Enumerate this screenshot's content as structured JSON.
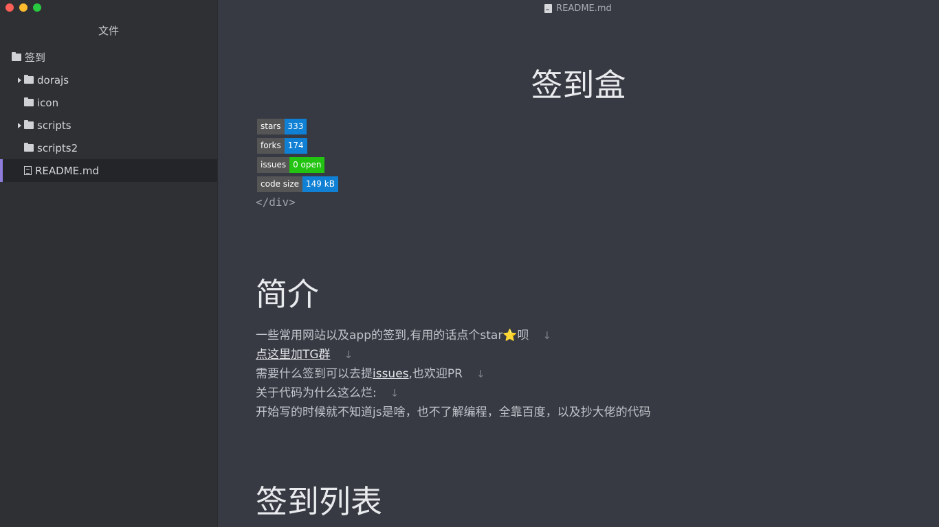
{
  "window": {
    "title": "README.md"
  },
  "sidebar": {
    "header": "文件",
    "items": [
      {
        "label": "签到",
        "type": "folder",
        "level": 0,
        "expandable": false
      },
      {
        "label": "dorajs",
        "type": "folder",
        "level": 1,
        "expandable": true
      },
      {
        "label": "icon",
        "type": "folder",
        "level": 1,
        "expandable": false
      },
      {
        "label": "scripts",
        "type": "folder",
        "level": 1,
        "expandable": true
      },
      {
        "label": "scripts2",
        "type": "folder",
        "level": 1,
        "expandable": false
      },
      {
        "label": "README.md",
        "type": "file",
        "level": 1,
        "active": true
      }
    ]
  },
  "content": {
    "title": "签到盒",
    "badges": [
      {
        "left": "stars",
        "right": "333",
        "color": "#0f80d4"
      },
      {
        "left": "forks",
        "right": "174",
        "color": "#0f80d4"
      },
      {
        "left": "issues",
        "right": "0 open",
        "color": "#22c311"
      },
      {
        "left": "code size",
        "right": "149 kB",
        "color": "#0f80d4"
      }
    ],
    "code_end": "</div>",
    "section1_title": "简介",
    "para1_text": "一些常用网站以及app的签到,有用的话点个star",
    "para1_star": "⭐",
    "para1_tail": "呗",
    "para2_link": "点这里加TG群",
    "para3_pre": "需要什么签到可以去提",
    "para3_link": "issues",
    "para3_post": ",也欢迎PR",
    "para4": "关于代码为什么这么烂:",
    "para5": "开始写的时候就不知道js是啥，也不了解编程，全靠百度，以及抄大佬的代码",
    "newline_mark": "↓",
    "section2_title": "签到列表"
  }
}
